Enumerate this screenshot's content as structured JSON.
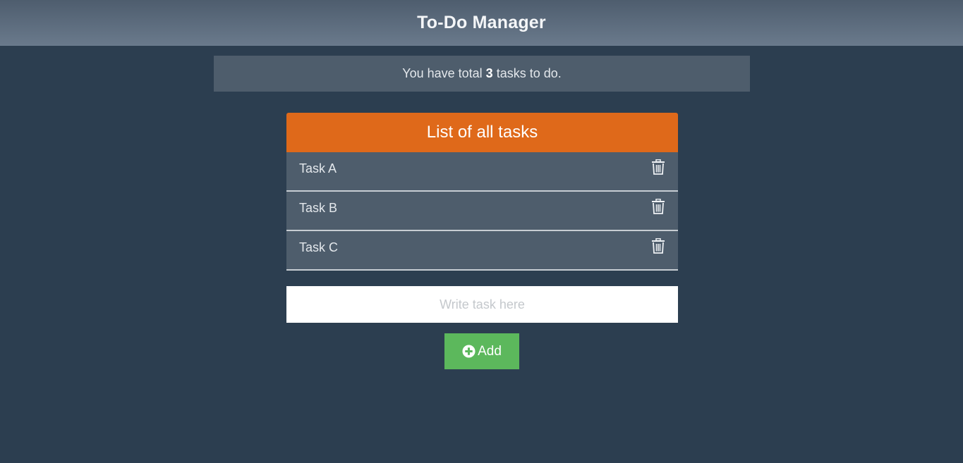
{
  "header": {
    "title": "To-Do Manager"
  },
  "summary": {
    "prefix": "You have total",
    "count": "3",
    "suffix": "tasks to do."
  },
  "task_list": {
    "title": "List of all tasks",
    "tasks": [
      {
        "label": "Task A",
        "delete_icon": "trash-icon"
      },
      {
        "label": "Task B",
        "delete_icon": "trash-icon"
      },
      {
        "label": "Task C",
        "delete_icon": "trash-icon"
      }
    ]
  },
  "new_task": {
    "placeholder": "Write task here",
    "value": ""
  },
  "add_button": {
    "label": "Add",
    "icon": "plus-circle-icon"
  },
  "colors": {
    "background": "#2c3e50",
    "header_accent": "#df691a",
    "add_button": "#5cb85c",
    "panel": "#4e5d6c"
  }
}
